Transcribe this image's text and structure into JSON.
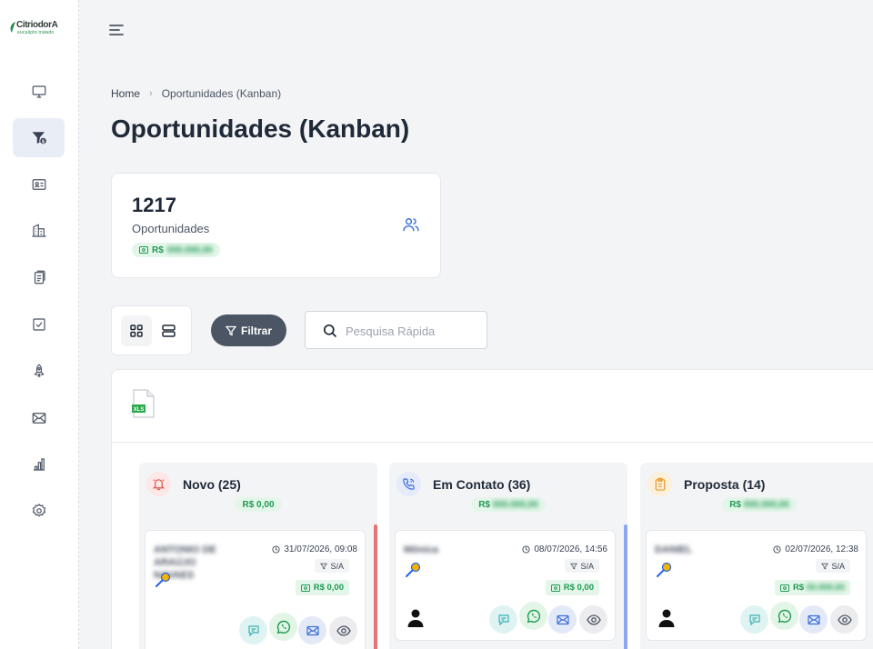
{
  "brand": {
    "name": "CitriodorA",
    "tagline": "eucalipto tratado"
  },
  "sidebar": {
    "items": [
      {
        "id": "dashboard",
        "icon": "monitor-icon"
      },
      {
        "id": "opportunities",
        "icon": "funnel-dollar-icon",
        "active": true
      },
      {
        "id": "contacts",
        "icon": "contact-card-icon"
      },
      {
        "id": "companies",
        "icon": "building-icon"
      },
      {
        "id": "documents",
        "icon": "documents-icon"
      },
      {
        "id": "tasks",
        "icon": "checkbox-icon"
      },
      {
        "id": "campaigns",
        "icon": "rocket-icon"
      },
      {
        "id": "email",
        "icon": "envelope-icon"
      },
      {
        "id": "reports",
        "icon": "bar-chart-icon"
      },
      {
        "id": "settings",
        "icon": "gear-icon"
      }
    ]
  },
  "breadcrumb": {
    "home": "Home",
    "current": "Oportunidades (Kanban)"
  },
  "page": {
    "title": "Oportunidades (Kanban)"
  },
  "stats": {
    "count": "1217",
    "label": "Oportunidades",
    "amount_prefix": "R$",
    "amount": "000.000,00"
  },
  "toolbar": {
    "filter_label": "Filtrar",
    "search_placeholder": "Pesquisa Rápida"
  },
  "export": {
    "icon_label": "XLS"
  },
  "columns": [
    {
      "title": "Novo (25)",
      "icon": "bell-icon",
      "accent": "#e57373",
      "total": "R$ 0,00",
      "card": {
        "name": "ANTONIO DE ARAÚJO NAVAES",
        "date": "31/07/2026, 09:08",
        "source": "S/A",
        "value": "R$ 0,00",
        "has_person": false
      }
    },
    {
      "title": "Em Contato (36)",
      "icon": "phone-icon",
      "accent": "#8ea7ef",
      "total": "R$ 000.000,00",
      "card": {
        "name": "Mônica",
        "date": "08/07/2026, 14:56",
        "source": "S/A",
        "value": "R$ 0,00",
        "has_person": true
      }
    },
    {
      "title": "Proposta (14)",
      "icon": "clipboard-icon",
      "accent": "#f0b35a",
      "total": "R$ 000.000,00",
      "card": {
        "name": "DANIEL",
        "date": "02/07/2026, 12:38",
        "source": "S/A",
        "value": "R$ 00.000,00",
        "has_person": true
      }
    }
  ],
  "colors": {
    "accent_dark": "#4b5563",
    "money_green": "#1f9a52",
    "money_bg": "#e4f6ea",
    "primary_blue": "#3b6fd8"
  }
}
